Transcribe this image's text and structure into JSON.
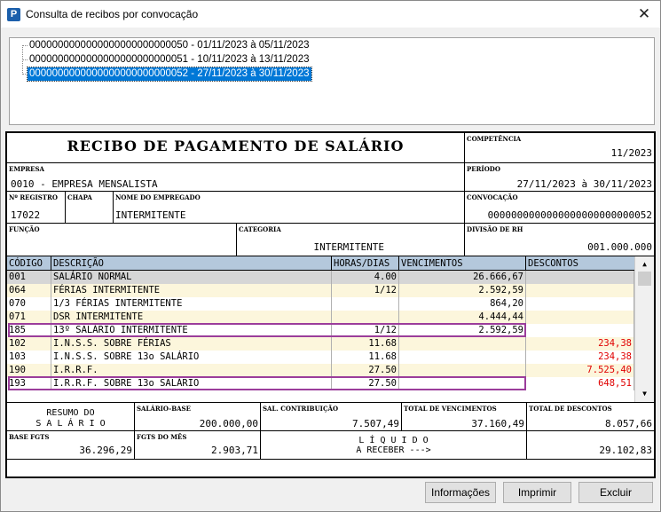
{
  "window": {
    "title": "Consulta de recibos por convocação",
    "app_icon": "P"
  },
  "tree": {
    "items": [
      {
        "label": "0000000000000000000000000050 - 01/11/2023 à 05/11/2023",
        "selected": false
      },
      {
        "label": "0000000000000000000000000051 - 10/11/2023 à 13/11/2023",
        "selected": false
      },
      {
        "label": "0000000000000000000000000052 - 27/11/2023 à 30/11/2023",
        "selected": true
      }
    ]
  },
  "receipt": {
    "title": "RECIBO DE PAGAMENTO DE SALÁRIO",
    "competencia_label": "COMPETÊNCIA",
    "competencia": "11/2023",
    "empresa_label": "EMPRESA",
    "empresa": "0010 - EMPRESA MENSALISTA",
    "periodo_label": "PERÍODO",
    "periodo": "27/11/2023 à 30/11/2023",
    "registro_label": "Nº REGISTRO",
    "registro": "17022",
    "chapa_label": "CHAPA",
    "chapa": "",
    "nome_label": "NOME DO EMPREGADO",
    "nome": "INTERMITENTE",
    "convocacao_label": "CONVOCAÇÃO",
    "convocacao": "0000000000000000000000000052",
    "funcao_label": "FUNÇÃO",
    "funcao": "",
    "categoria_label": "CATEGORIA",
    "categoria": "INTERMITENTE",
    "divisao_label": "DIVISÃO DE RH",
    "divisao": "001.000.000"
  },
  "grid": {
    "headers": {
      "codigo": "CÓDIGO",
      "descricao": "DESCRIÇÃO",
      "horas": "HORAS/DIAS",
      "vencimentos": "VENCIMENTOS",
      "descontos": "DESCONTOS"
    },
    "rows": [
      {
        "codigo": "001",
        "descricao": "SALÁRIO NORMAL",
        "horas": "4.00",
        "vencimentos": "26.666,67",
        "descontos": ""
      },
      {
        "codigo": "064",
        "descricao": "FÉRIAS INTERMITENTE",
        "horas": "1/12",
        "vencimentos": "2.592,59",
        "descontos": ""
      },
      {
        "codigo": "070",
        "descricao": "1/3 FÉRIAS INTERMITENTE",
        "horas": "",
        "vencimentos": "864,20",
        "descontos": ""
      },
      {
        "codigo": "071",
        "descricao": "DSR INTERMITENTE",
        "horas": "",
        "vencimentos": "4.444,44",
        "descontos": ""
      },
      {
        "codigo": "185",
        "descricao": "13º SALÁRIO INTERMITENTE",
        "horas": "1/12",
        "vencimentos": "2.592,59",
        "descontos": ""
      },
      {
        "codigo": "102",
        "descricao": "I.N.S.S. SOBRE FÉRIAS",
        "horas": "11.68",
        "vencimentos": "",
        "descontos": "234,38"
      },
      {
        "codigo": "103",
        "descricao": "I.N.S.S. SOBRE 13o SALÁRIO",
        "horas": "11.68",
        "vencimentos": "",
        "descontos": "234,38"
      },
      {
        "codigo": "190",
        "descricao": "I.R.R.F.",
        "horas": "27.50",
        "vencimentos": "",
        "descontos": "7.525,40"
      },
      {
        "codigo": "193",
        "descricao": "I.R.R.F. SOBRE 13o SALÁRIO",
        "horas": "27.50",
        "vencimentos": "",
        "descontos": "648,51"
      }
    ],
    "highlight_color": "#9b3d9b",
    "discount_color": "#e00000"
  },
  "summary": {
    "resumo_line1": "RESUMO DO",
    "resumo_line2": "S A L Á R I O",
    "salario_base_label": "SALÁRIO-BASE",
    "salario_base": "200.000,00",
    "sal_contrib_label": "SAL. CONTRIBUIÇÃO",
    "sal_contrib": "7.507,49",
    "total_venc_label": "TOTAL DE VENCIMENTOS",
    "total_venc": "37.160,49",
    "total_desc_label": "TOTAL DE DESCONTOS",
    "total_desc": "8.057,66",
    "base_fgts_label": "BASE FGTS",
    "base_fgts": "36.296,29",
    "fgts_mes_label": "FGTS DO MÊS",
    "fgts_mes": "2.903,71",
    "liquido_line1": "L Í Q U I D O",
    "liquido_line2": "A RECEBER --->",
    "liquido": "29.102,83"
  },
  "buttons": {
    "info": "Informações",
    "print": "Imprimir",
    "delete": "Excluir"
  }
}
